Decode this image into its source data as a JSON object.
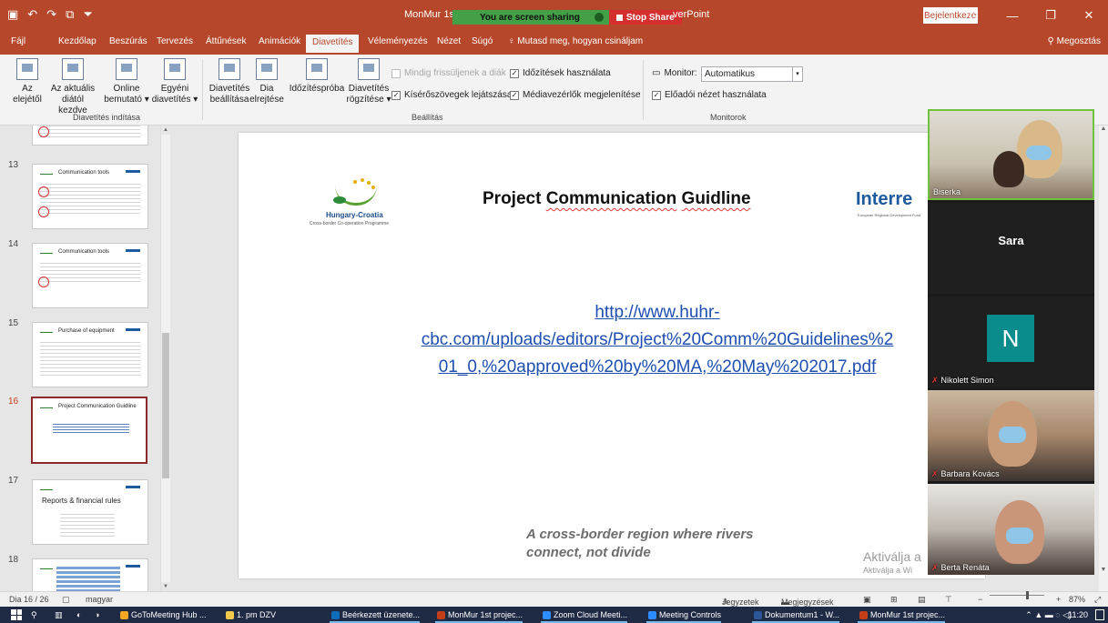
{
  "titlebar": {
    "doc_title": "MonMur 1st pr",
    "app_suffix": "verPoint",
    "screen_sharing": "You are screen sharing",
    "stop_share": "Stop Share",
    "sign_in": "Bejelentkezés",
    "qat_icons": [
      "save-icon",
      "undo-icon",
      "redo-icon",
      "start-from-beginning-icon",
      "customize-qat-icon"
    ]
  },
  "tabs": {
    "items": [
      "Fájl",
      "Kezdőlap",
      "Beszúrás",
      "Tervezés",
      "Áttűnések",
      "Animációk",
      "Diavetítés",
      "Véleményezés",
      "Nézet",
      "Súgó"
    ],
    "active": "Diavetítés",
    "tell_me": "Mutasd meg, hogyan csináljam",
    "share": "Megosztás"
  },
  "ribbon": {
    "start_group": {
      "label": "Diavetítés indítása",
      "buttons": [
        {
          "line1": "Az",
          "line2": "elejétől"
        },
        {
          "line1": "Az aktuális",
          "line2": "diától kezdve"
        },
        {
          "line1": "Online",
          "line2": "bemutató ▾"
        },
        {
          "line1": "Egyéni",
          "line2": "diavetítés ▾"
        }
      ]
    },
    "setup_group": {
      "label": "Beállítás",
      "buttons": [
        {
          "line1": "Diavetítés",
          "line2": "beállítása"
        },
        {
          "line1": "Dia",
          "line2": "elrejtése"
        },
        {
          "line1": "Időzítéspróba",
          "line2": ""
        },
        {
          "line1": "Diavetítés",
          "line2": "rögzítése ▾"
        }
      ],
      "checks": [
        {
          "label": "Mindig frissüljenek a diák",
          "checked": false,
          "disabled": true
        },
        {
          "label": "Időzítések használata",
          "checked": true,
          "disabled": false
        },
        {
          "label": "Kísérőszövegek lejátszása",
          "checked": true,
          "disabled": false
        },
        {
          "label": "Médiavezérlők megjelenítése",
          "checked": true,
          "disabled": false
        }
      ]
    },
    "monitors_group": {
      "label": "Monitorok",
      "monitor_label": "Monitor:",
      "monitor_value": "Automatikus",
      "presenter_view": "Előadói nézet használata"
    }
  },
  "thumbnails": [
    {
      "num": "13",
      "title": "Communication tools",
      "kind": "table-circles",
      "active": false
    },
    {
      "num": "14",
      "title": "Communication tools",
      "kind": "table-circle",
      "active": false
    },
    {
      "num": "15",
      "title": "Purchase of equipment",
      "kind": "text",
      "active": false
    },
    {
      "num": "16",
      "title": "Project Communication Guidline",
      "kind": "link",
      "active": true
    },
    {
      "num": "17",
      "title": "Reports & financial rules",
      "kind": "title",
      "active": false
    },
    {
      "num": "18",
      "title": "",
      "kind": "table",
      "active": false
    }
  ],
  "slide": {
    "logo_name": "Hungary-Croatia",
    "logo_sub": "Cross-border Co-operation Programme",
    "title_word1": "Project",
    "title_word2": "Communication",
    "title_word3": "Guidline",
    "interreg": "Interre",
    "interreg_sub": "European Regional Development Fund",
    "link_line1": "http://www.huhr-",
    "link_line2": "cbc.com/uploads/editors/Project%20Comm%20Guidelines%2",
    "link_line3": "01_0,%20approved%20by%20MA,%20May%202017.pdf",
    "tagline_line1": "A cross-border region where rivers",
    "tagline_line2": "connect, not divide",
    "activate_line1": "Aktiválja a",
    "activate_line2": "Aktiválja a Wi"
  },
  "video_tiles": [
    {
      "name": "Biserka",
      "muted": false
    },
    {
      "name": "Sara",
      "muted": false
    },
    {
      "name": "Nikolett Simon",
      "initial": "N",
      "muted": true
    },
    {
      "name": "Barbara Kovács",
      "muted": true
    },
    {
      "name": "Berta Renáta",
      "muted": true
    }
  ],
  "statusbar": {
    "slide_info": "Dia 16 / 26",
    "language": "magyar",
    "notes": "Jegyzetek",
    "comments": "Megjegyzések",
    "zoom": "87%"
  },
  "taskbar": {
    "items": [
      {
        "label": "GoToMeeting Hub ...",
        "color": "#f5a623",
        "open": false
      },
      {
        "label": "1. pm DZV",
        "color": "#f2c94c",
        "open": false
      },
      {
        "label": "Beérkezett üzenete...",
        "color": "#0f6cbd",
        "open": true
      },
      {
        "label": "MonMur 1st projec...",
        "color": "#c43e1c",
        "open": true
      },
      {
        "label": "Zoom Cloud Meeti...",
        "color": "#2d8cff",
        "open": true
      },
      {
        "label": "Meeting Controls",
        "color": "#2d8cff",
        "open": true
      },
      {
        "label": "Dokumentum1 - W...",
        "color": "#2b579a",
        "open": true
      },
      {
        "label": "MonMur 1st projec...",
        "color": "#c43e1c",
        "open": true
      }
    ],
    "clock": "11:20"
  }
}
